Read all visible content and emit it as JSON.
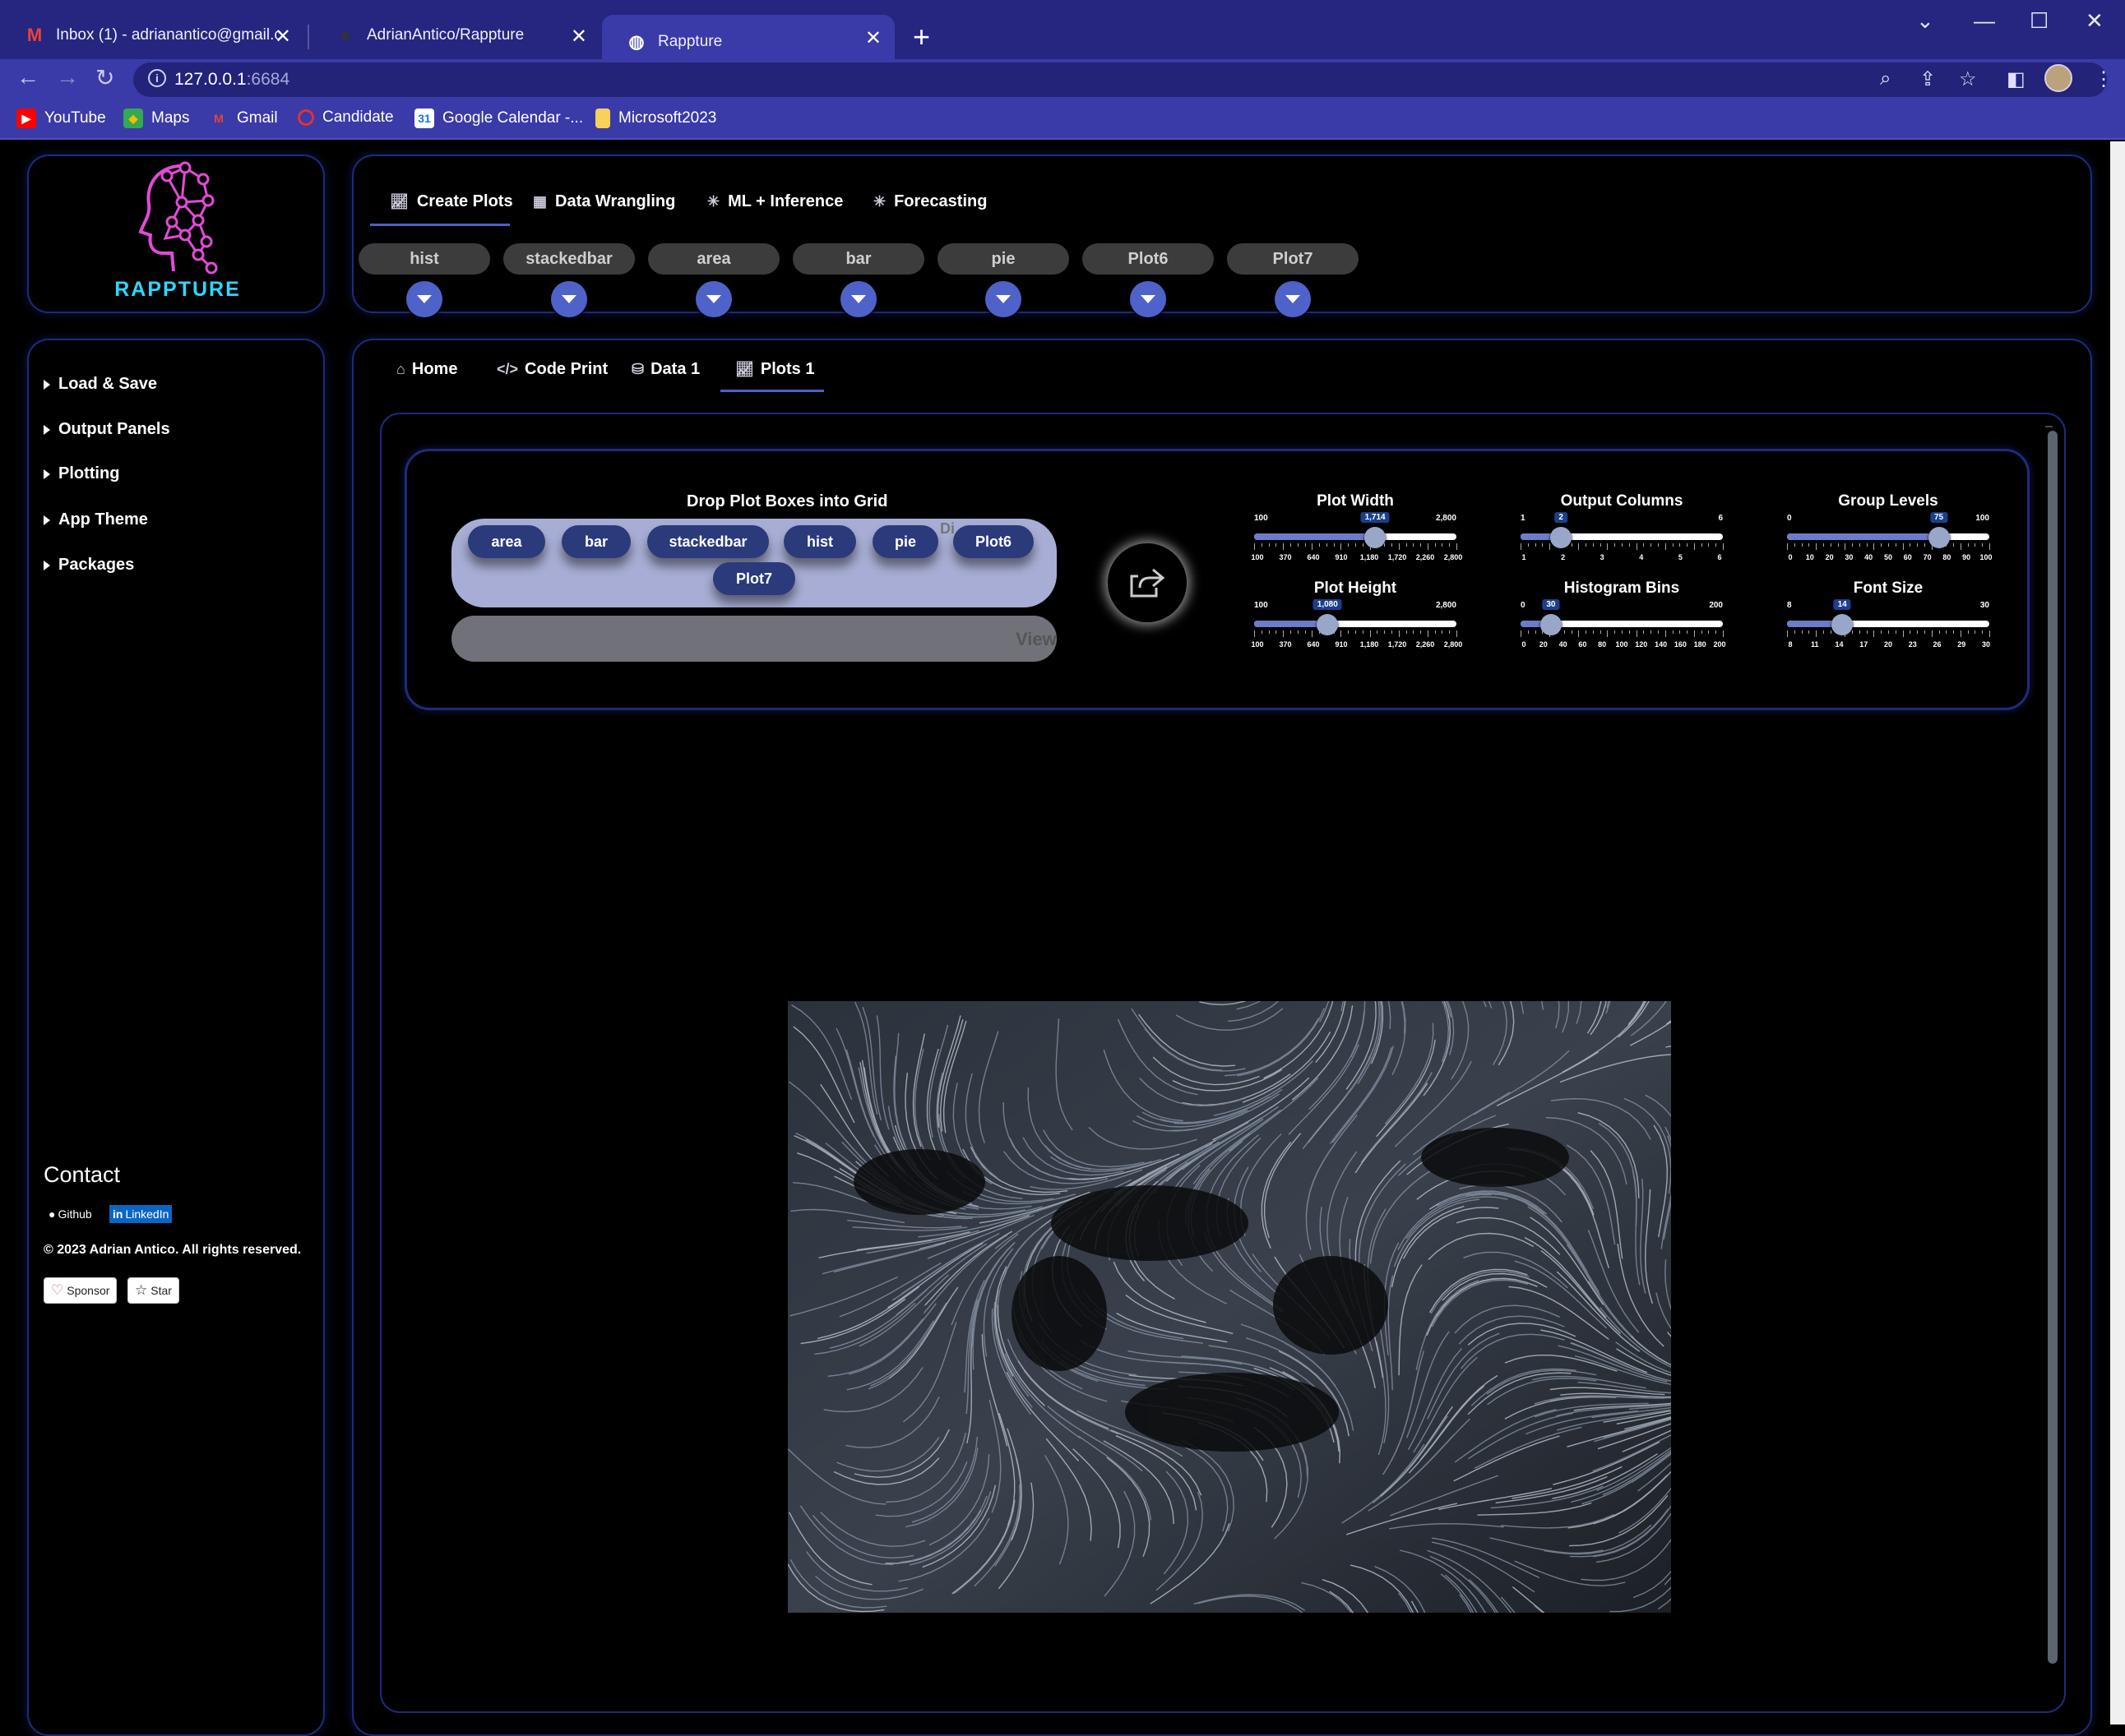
{
  "browser": {
    "tabs": [
      {
        "title": "Inbox (1) - adrianantico@gmail.c",
        "favicon": "gmail-icon"
      },
      {
        "title": "AdrianAntico/Rappture",
        "favicon": "github-icon"
      },
      {
        "title": "Rappture",
        "favicon": "globe-icon"
      }
    ],
    "url_host": "127.0.0.1",
    "url_port": ":6684",
    "bookmarks": [
      "YouTube",
      "Maps",
      "Gmail",
      "Candidate",
      "Google Calendar -...",
      "Microsoft2023"
    ]
  },
  "app": {
    "logo_text": "RAPPTURE",
    "top_tabs": [
      "Create Plots",
      "Data Wrangling",
      "ML + Inference",
      "Forecasting"
    ],
    "plot_pills": [
      "hist",
      "stackedbar",
      "area",
      "bar",
      "pie",
      "Plot6",
      "Plot7"
    ],
    "sidebar": {
      "items": [
        "Load & Save",
        "Output Panels",
        "Plotting",
        "App Theme",
        "Packages"
      ],
      "contact_title": "Contact",
      "badges": [
        "Github",
        "LinkedIn"
      ],
      "copyright": "© 2023 Adrian Antico. All rights reserved.",
      "sponsor_label": "Sponsor",
      "star_label": "Star"
    },
    "sub_tabs": [
      "Home",
      "Code Print",
      "Data 1",
      "Plots 1"
    ],
    "drop": {
      "title": "Drop Plot Boxes into Grid",
      "chips": [
        "area",
        "bar",
        "stackedbar",
        "hist",
        "pie",
        "Plot6",
        "Plot7"
      ],
      "ghost_view": "View",
      "ghost_di": "Di"
    },
    "sliders": {
      "plot_width": {
        "title": "Plot Width",
        "min": "100",
        "max": "2,800",
        "value": "1,714",
        "frac": 0.598,
        "ticks": [
          "100",
          "370",
          "640",
          "910",
          "1,180",
          "1,720",
          "2,260",
          "2,800"
        ]
      },
      "output_columns": {
        "title": "Output Columns",
        "min": "1",
        "max": "6",
        "value": "2",
        "frac": 0.2,
        "ticks": [
          "1",
          "2",
          "3",
          "4",
          "5",
          "6"
        ]
      },
      "group_levels": {
        "title": "Group Levels",
        "min": "0",
        "max": "100",
        "value": "75",
        "frac": 0.75,
        "ticks": [
          "0",
          "10",
          "20",
          "30",
          "40",
          "50",
          "60",
          "70",
          "80",
          "90",
          "100"
        ]
      },
      "plot_height": {
        "title": "Plot Height",
        "min": "100",
        "max": "2,800",
        "value": "1,080",
        "frac": 0.363,
        "ticks": [
          "100",
          "370",
          "640",
          "910",
          "1,180",
          "1,720",
          "2,260",
          "2,800"
        ]
      },
      "histogram_bins": {
        "title": "Histogram Bins",
        "min": "0",
        "max": "200",
        "value": "30",
        "frac": 0.15,
        "ticks": [
          "0",
          "20",
          "40",
          "60",
          "80",
          "100",
          "120",
          "140",
          "160",
          "180",
          "200"
        ]
      },
      "font_size": {
        "title": "Font Size",
        "min": "8",
        "max": "30",
        "value": "14",
        "frac": 0.273,
        "ticks": [
          "8",
          "11",
          "14",
          "17",
          "20",
          "23",
          "26",
          "29",
          "30"
        ]
      }
    }
  }
}
